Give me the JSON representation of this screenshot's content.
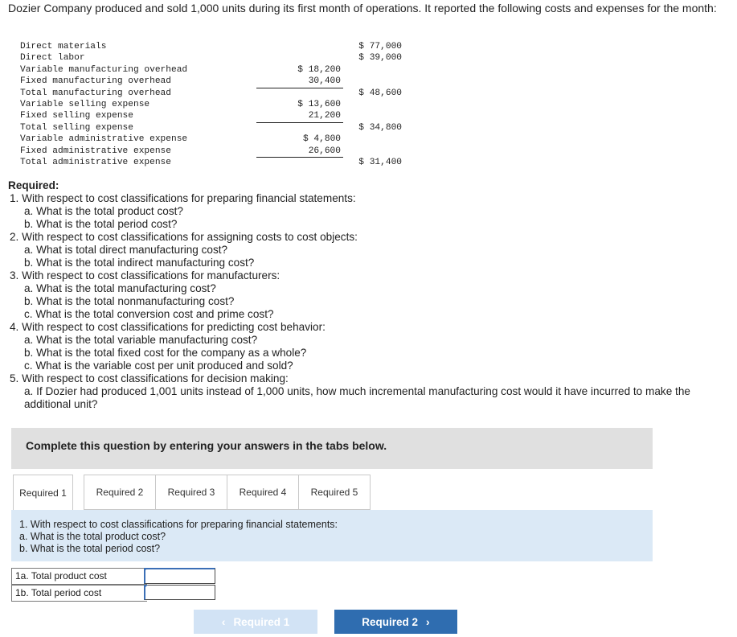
{
  "intro": "Dozier Company produced and sold 1,000 units during its first month of operations. It reported the following costs and expenses for the month:",
  "cost_rows": [
    {
      "label": "Direct materials",
      "col1": "",
      "col2": "$ 77,000"
    },
    {
      "label": "Direct labor",
      "col1": "",
      "col2": "$ 39,000"
    },
    {
      "label": "Variable manufacturing overhead",
      "col1": "$ 18,200",
      "col2": ""
    },
    {
      "label": "Fixed manufacturing overhead",
      "col1": "30,400",
      "col2": ""
    },
    {
      "label": "Total manufacturing overhead",
      "col1": "",
      "col2": "$ 48,600"
    },
    {
      "label": "Variable selling expense",
      "col1": "$ 13,600",
      "col2": ""
    },
    {
      "label": "Fixed selling expense",
      "col1": "21,200",
      "col2": ""
    },
    {
      "label": "Total selling expense",
      "col1": "",
      "col2": "$ 34,800"
    },
    {
      "label": "Variable administrative expense",
      "col1": "$ 4,800",
      "col2": ""
    },
    {
      "label": "Fixed administrative expense",
      "col1": "26,600",
      "col2": ""
    },
    {
      "label": "Total administrative expense",
      "col1": "",
      "col2": "$ 31,400"
    }
  ],
  "requirements": {
    "heading": "Required:",
    "lines": [
      {
        "level": 1,
        "text": "1. With respect to cost classifications for preparing financial statements:"
      },
      {
        "level": 2,
        "text": "a. What is the total product cost?"
      },
      {
        "level": 2,
        "text": "b. What is the total period cost?"
      },
      {
        "level": 1,
        "text": "2. With respect to cost classifications for assigning costs to cost objects:"
      },
      {
        "level": 2,
        "text": "a. What is total direct manufacturing cost?"
      },
      {
        "level": 2,
        "text": "b. What is the total indirect manufacturing cost?"
      },
      {
        "level": 1,
        "text": "3. With respect to cost classifications for manufacturers:"
      },
      {
        "level": 2,
        "text": "a. What is the total manufacturing cost?"
      },
      {
        "level": 2,
        "text": "b. What is the total nonmanufacturing cost?"
      },
      {
        "level": 2,
        "text": "c. What is the total conversion cost and prime cost?"
      },
      {
        "level": 1,
        "text": "4. With respect to cost classifications for predicting cost behavior:"
      },
      {
        "level": 2,
        "text": "a. What is the total variable manufacturing cost?"
      },
      {
        "level": 2,
        "text": "b. What is the total fixed cost for the company as a whole?"
      },
      {
        "level": 2,
        "text": "c. What is the variable cost per unit produced and sold?"
      },
      {
        "level": 1,
        "text": "5. With respect to cost classifications for decision making:"
      },
      {
        "level": 2,
        "text": "a. If Dozier had produced 1,001 units instead of 1,000 units, how much incremental manufacturing cost would it have incurred to make the additional unit?"
      }
    ]
  },
  "banner": "Complete this question by entering your answers in the tabs below.",
  "tabs": [
    "Required 1",
    "Required 2",
    "Required 3",
    "Required 4",
    "Required 5"
  ],
  "active_tab": 0,
  "tab_panel": {
    "line1": "1. With respect to cost classifications for preparing financial statements:",
    "line2": "a. What is the total product cost?",
    "line3": "b. What is the total period cost?"
  },
  "answers": [
    {
      "label": "1a. Total product cost",
      "value": ""
    },
    {
      "label": "1b. Total period cost",
      "value": ""
    }
  ],
  "nav": {
    "prev_label": "Required 1",
    "next_label": "Required 2",
    "prev_icon": "chevron-left-icon",
    "next_icon": "chevron-right-icon"
  },
  "colors": {
    "banner_bg": "#e0e0e0",
    "panel_bg": "#dbe9f6",
    "next_button": "#2f6db0",
    "prev_button_disabled": "#d2e3f5",
    "input_accent": "#3b6fb6"
  }
}
